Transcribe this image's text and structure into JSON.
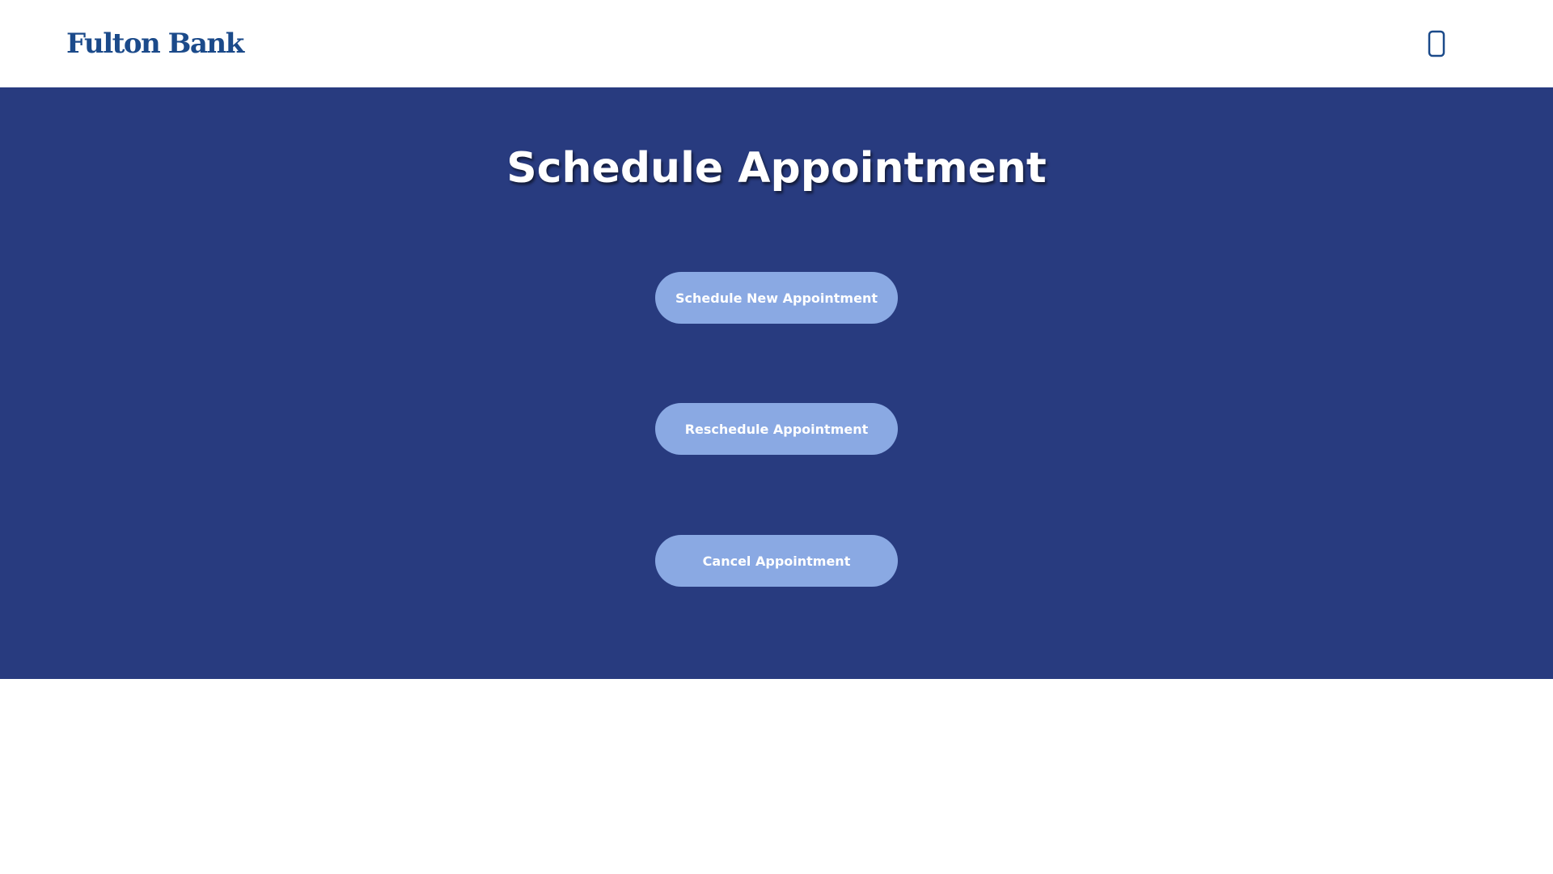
{
  "header": {
    "logo_text": "Fulton Bank",
    "phone_icon": "mobile-phone-icon",
    "brand_color": "#1b4a8a"
  },
  "hero": {
    "title": "Schedule Appointment",
    "background_color": "#283b7f",
    "button_color": "#8aa9e3",
    "buttons": {
      "schedule_new": "Schedule New Appointment",
      "reschedule": "Reschedule Appointment",
      "cancel": "Cancel Appointment"
    }
  }
}
